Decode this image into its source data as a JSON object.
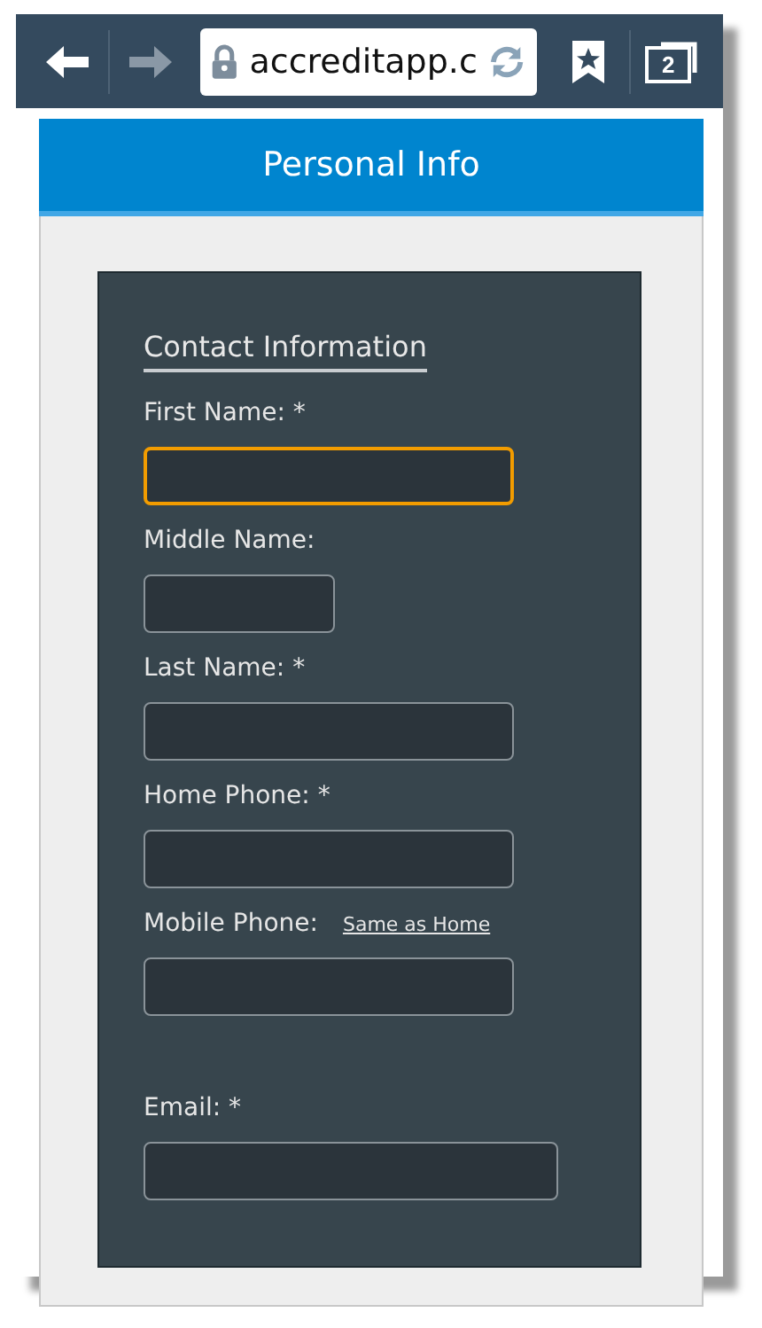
{
  "browser": {
    "url": "accreditapp.c",
    "tab_count": "2"
  },
  "header": {
    "title": "Personal Info"
  },
  "form": {
    "section_title": "Contact Information",
    "fields": [
      {
        "label": "First Name: *",
        "kind": "standard",
        "focused": true
      },
      {
        "label": "Middle Name:",
        "kind": "short",
        "focused": false
      },
      {
        "label": "Last Name: *",
        "kind": "standard",
        "focused": false
      },
      {
        "label": "Home Phone: *",
        "kind": "standard",
        "focused": false
      },
      {
        "label": "Mobile Phone:",
        "link": "Same as Home",
        "kind": "standard",
        "focused": false
      },
      {
        "label": "Email: *",
        "kind": "wide",
        "focused": false
      }
    ]
  }
}
